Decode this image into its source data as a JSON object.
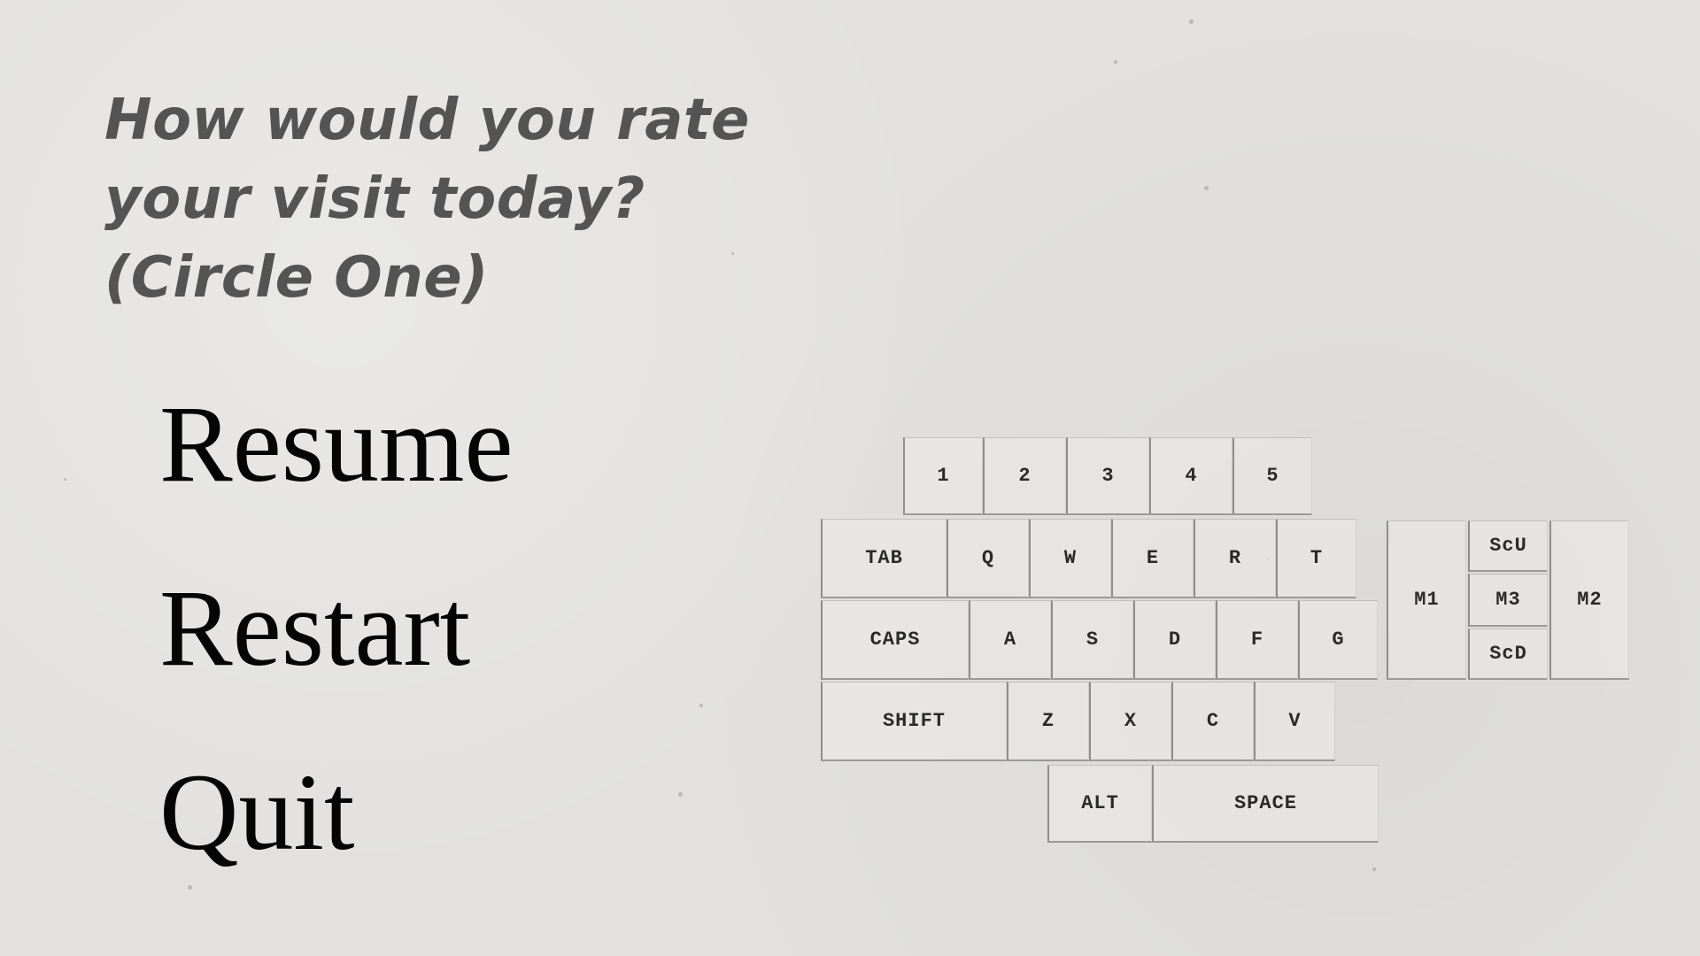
{
  "prompt": {
    "lines": [
      "How would you rate",
      "your visit today?",
      "(Circle One)"
    ]
  },
  "menu": {
    "resume": "Resume",
    "restart": "Restart",
    "quit": "Quit"
  },
  "keyboard": {
    "row_numbers": [
      "1",
      "2",
      "3",
      "4",
      "5"
    ],
    "row_top": [
      "TAB",
      "Q",
      "W",
      "E",
      "R",
      "T"
    ],
    "row_home": [
      "CAPS",
      "A",
      "S",
      "D",
      "F",
      "G"
    ],
    "row_bottom": [
      "SHIFT",
      "Z",
      "X",
      "C",
      "V"
    ],
    "row_space": [
      "ALT",
      "SPACE"
    ],
    "mouse": {
      "m1": "M1",
      "scroll_up": "ScU",
      "m3": "M3",
      "scroll_down": "ScD",
      "m2": "M2"
    }
  }
}
